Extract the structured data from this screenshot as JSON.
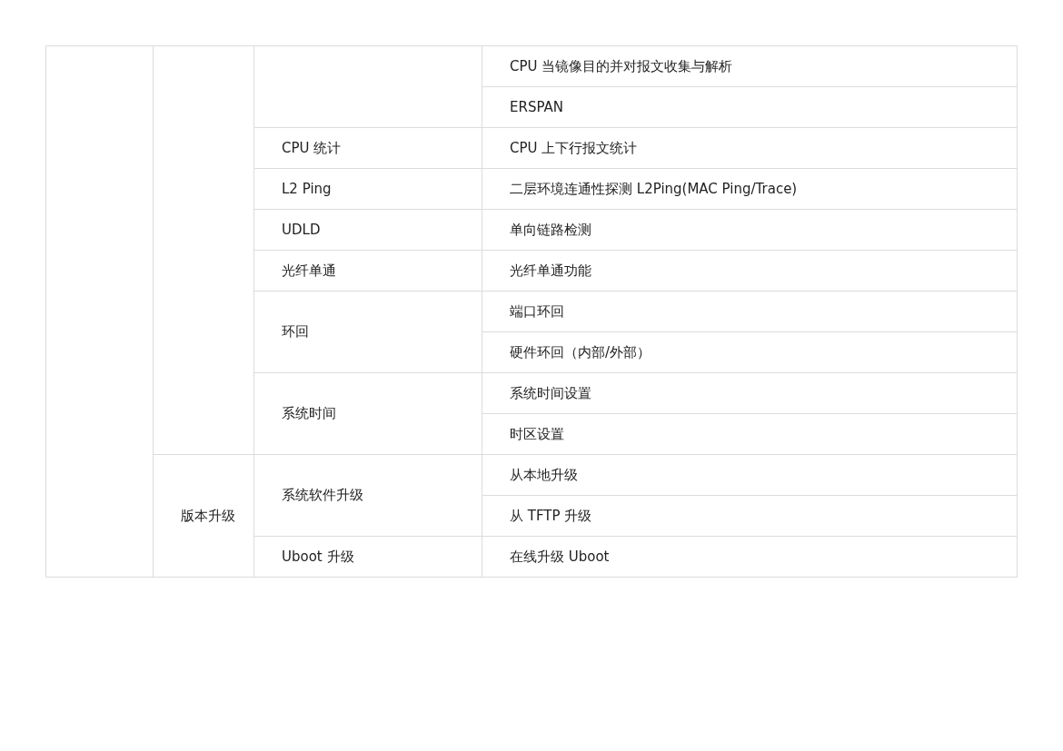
{
  "table": {
    "groups": [
      {
        "features": [
          {
            "items": [
              "CPU 当镜像目的并对报文收集与解析",
              "ERSPAN"
            ]
          },
          {
            "name": "CPU 统计",
            "items": [
              "CPU 上下行报文统计"
            ]
          },
          {
            "name": "L2 Ping",
            "items": [
              "二层环境连通性探测 L2Ping(MAC Ping/Trace)"
            ]
          },
          {
            "name": "UDLD",
            "items": [
              "单向链路检测"
            ]
          },
          {
            "name": "光纤单通",
            "items": [
              "光纤单通功能"
            ]
          },
          {
            "name": "环回",
            "items": [
              "端口环回",
              "硬件环回（内部/外部）"
            ]
          },
          {
            "name": "系统时间",
            "items": [
              "系统时间设置",
              "时区设置"
            ]
          }
        ]
      },
      {
        "name": "版本升级",
        "features": [
          {
            "name": "系统软件升级",
            "items": [
              "从本地升级",
              "从 TFTP 升级"
            ]
          },
          {
            "name": "Uboot 升级",
            "items": [
              "在线升级 Uboot"
            ]
          }
        ]
      }
    ]
  }
}
